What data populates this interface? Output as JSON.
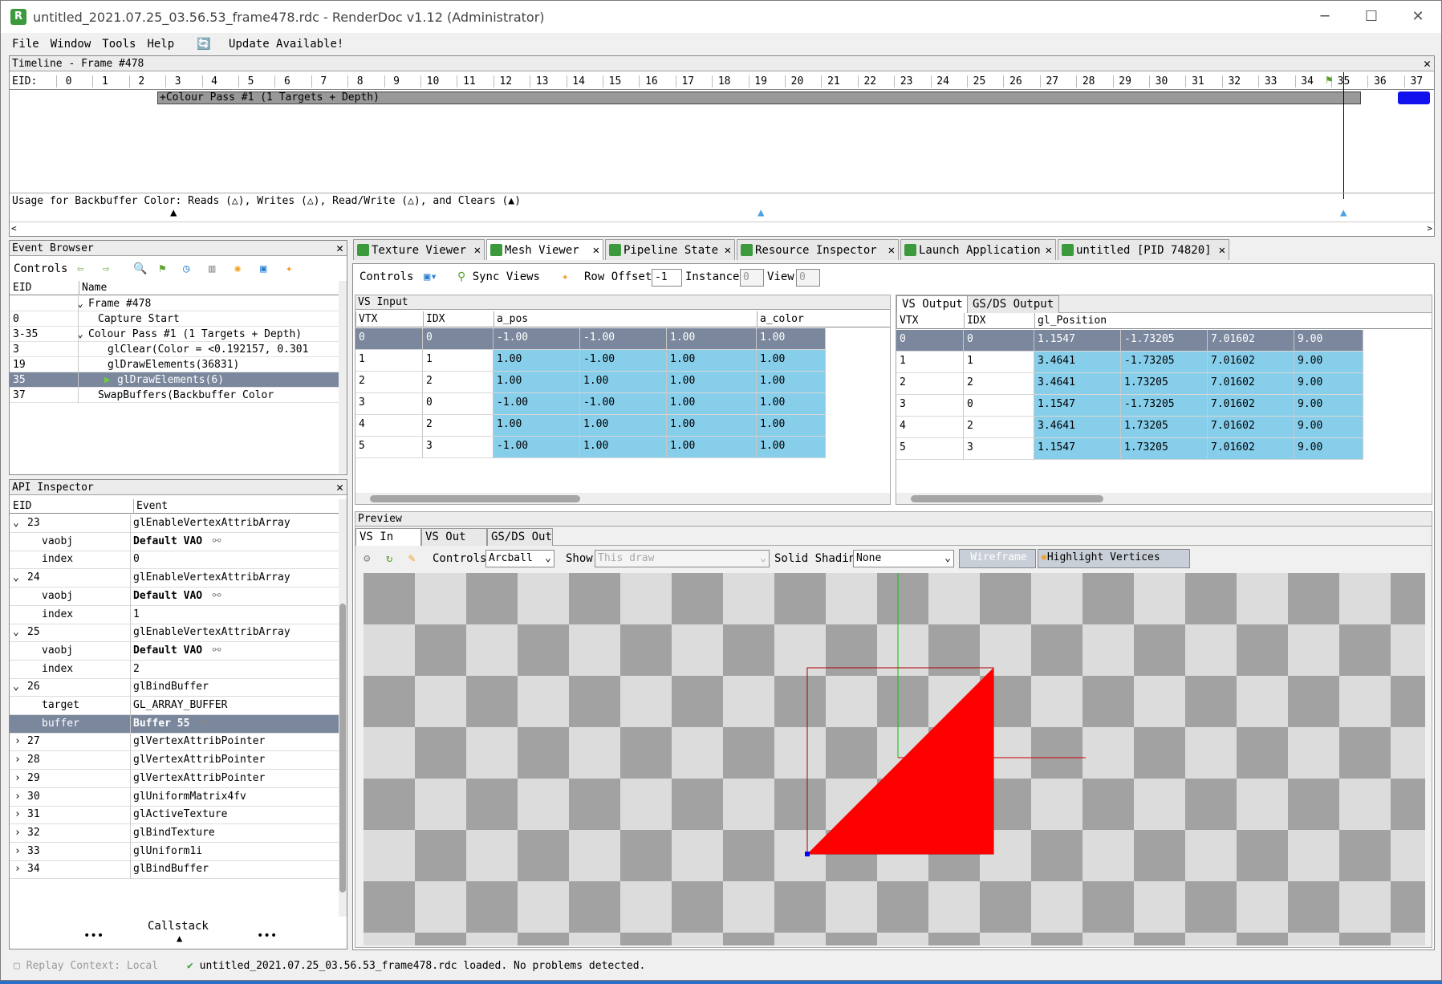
{
  "window": {
    "title": "untitled_2021.07.25_03.56.53_frame478.rdc - RenderDoc v1.12 (Administrator)",
    "minimize": "─",
    "maximize": "☐",
    "close": "✕"
  },
  "menu": {
    "file": "File",
    "window": "Window",
    "tools": "Tools",
    "help": "Help",
    "update": "Update Available!"
  },
  "timeline": {
    "title": "Timeline - Frame #478",
    "eid_label": "EID:",
    "ticks": [
      "0",
      "1",
      "2",
      "3",
      "4",
      "5",
      "6",
      "7",
      "8",
      "9",
      "10",
      "11",
      "12",
      "13",
      "14",
      "15",
      "16",
      "17",
      "18",
      "19",
      "20",
      "21",
      "22",
      "23",
      "24",
      "25",
      "26",
      "27",
      "28",
      "29",
      "30",
      "31",
      "32",
      "33",
      "34",
      "35",
      "36",
      "37"
    ],
    "pass_label": "+Colour Pass #1 (1 Targets + Depth)",
    "usage_text": "Usage for Backbuffer Color: Reads (△), Writes (△), Read/Write (△), and Clears (▲)"
  },
  "event_browser": {
    "title": "Event Browser",
    "controls_label": "Controls",
    "col_eid": "EID",
    "col_name": "Name",
    "rows": [
      {
        "eid": "",
        "name": "Frame #478",
        "indent": 1
      },
      {
        "eid": "0",
        "name": "Capture Start",
        "indent": 2
      },
      {
        "eid": "3-35",
        "name": "Colour Pass #1 (1 Targets + Depth)",
        "indent": 1
      },
      {
        "eid": "3",
        "name": "glClear(Color = <0.192157, 0.301",
        "indent": 3
      },
      {
        "eid": "19",
        "name": "glDrawElements(36831)",
        "indent": 3
      },
      {
        "eid": "35",
        "name": "glDrawElements(6)",
        "indent": 4
      },
      {
        "eid": "37",
        "name": "SwapBuffers(Backbuffer Color",
        "indent": 2
      }
    ]
  },
  "api_inspector": {
    "title": "API Inspector",
    "col_eid": "EID",
    "col_event": "Event",
    "callstack": "Callstack",
    "dots": "•••",
    "rows": [
      {
        "a": "23",
        "b": "glEnableVertexAttribArray",
        "kind": "expanded"
      },
      {
        "a": "vaobj",
        "b": "Default VAO",
        "kind": "child",
        "bold": true
      },
      {
        "a": "index",
        "b": "0",
        "kind": "child"
      },
      {
        "a": "24",
        "b": "glEnableVertexAttribArray",
        "kind": "expanded"
      },
      {
        "a": "vaobj",
        "b": "Default VAO",
        "kind": "child",
        "bold": true
      },
      {
        "a": "index",
        "b": "1",
        "kind": "child"
      },
      {
        "a": "25",
        "b": "glEnableVertexAttribArray",
        "kind": "expanded"
      },
      {
        "a": "vaobj",
        "b": "Default VAO",
        "kind": "child",
        "bold": true
      },
      {
        "a": "index",
        "b": "2",
        "kind": "child"
      },
      {
        "a": "26",
        "b": "glBindBuffer",
        "kind": "expanded"
      },
      {
        "a": "target",
        "b": "GL_ARRAY_BUFFER",
        "kind": "child"
      },
      {
        "a": "buffer",
        "b": "Buffer 55",
        "kind": "selected",
        "bold": true
      },
      {
        "a": "27",
        "b": "glVertexAttribPointer",
        "kind": "collapsed"
      },
      {
        "a": "28",
        "b": "glVertexAttribPointer",
        "kind": "collapsed"
      },
      {
        "a": "29",
        "b": "glVertexAttribPointer",
        "kind": "collapsed"
      },
      {
        "a": "30",
        "b": "glUniformMatrix4fv",
        "kind": "collapsed"
      },
      {
        "a": "31",
        "b": "glActiveTexture",
        "kind": "collapsed"
      },
      {
        "a": "32",
        "b": "glBindTexture",
        "kind": "collapsed"
      },
      {
        "a": "33",
        "b": "glUniform1i",
        "kind": "collapsed"
      },
      {
        "a": "34",
        "b": "glBindBuffer",
        "kind": "collapsed"
      }
    ]
  },
  "tabs": [
    {
      "label": "Texture Viewer"
    },
    {
      "label": "Mesh Viewer"
    },
    {
      "label": "Pipeline State"
    },
    {
      "label": "Resource Inspector"
    },
    {
      "label": "Launch Application"
    },
    {
      "label": "untitled [PID 74820]"
    }
  ],
  "mesh_toolbar": {
    "controls": "Controls",
    "sync_views": "Sync Views",
    "row_offset_label": "Row Offset",
    "row_offset": "-1",
    "instance_label": "Instance",
    "instance": "0",
    "view_label": "View",
    "view": "0"
  },
  "vs_input": {
    "title": "VS Input",
    "cols": [
      "VTX",
      "IDX",
      "a_pos",
      "a_color"
    ],
    "rows": [
      [
        "0",
        "0",
        "-1.00",
        "-1.00",
        "1.00",
        "1.00"
      ],
      [
        "1",
        "1",
        "1.00",
        "-1.00",
        "1.00",
        "1.00"
      ],
      [
        "2",
        "2",
        "1.00",
        "1.00",
        "1.00",
        "1.00"
      ],
      [
        "3",
        "0",
        "-1.00",
        "-1.00",
        "1.00",
        "1.00"
      ],
      [
        "4",
        "2",
        "1.00",
        "1.00",
        "1.00",
        "1.00"
      ],
      [
        "5",
        "3",
        "-1.00",
        "1.00",
        "1.00",
        "1.00"
      ]
    ]
  },
  "vs_output": {
    "tab1": "VS Output",
    "tab2": "GS/DS Output",
    "cols": [
      "VTX",
      "IDX",
      "gl_Position"
    ],
    "rows": [
      [
        "0",
        "0",
        "1.1547",
        "-1.73205",
        "7.01602",
        "9.00"
      ],
      [
        "1",
        "1",
        "3.4641",
        "-1.73205",
        "7.01602",
        "9.00"
      ],
      [
        "2",
        "2",
        "3.4641",
        "1.73205",
        "7.01602",
        "9.00"
      ],
      [
        "3",
        "0",
        "1.1547",
        "-1.73205",
        "7.01602",
        "9.00"
      ],
      [
        "4",
        "2",
        "3.4641",
        "1.73205",
        "7.01602",
        "9.00"
      ],
      [
        "5",
        "3",
        "1.1547",
        "1.73205",
        "7.01602",
        "9.00"
      ]
    ]
  },
  "preview": {
    "title": "Preview",
    "tab_vsin": "VS In",
    "tab_vsout": "VS Out",
    "tab_gsds": "GS/DS Out",
    "controls": "Controls",
    "controls_value": "Arcball",
    "show_label": "Show",
    "show_value": "This draw",
    "shading_label": "Solid Shading",
    "shading_value": "None",
    "wireframe": "Wireframe",
    "highlight": "Highlight Vertices",
    "triangle_color": "#ff0000"
  },
  "status": {
    "replay": "Replay Context: Local",
    "message": "untitled_2021.07.25_03.56.53_frame478.rdc loaded. No problems detected."
  }
}
